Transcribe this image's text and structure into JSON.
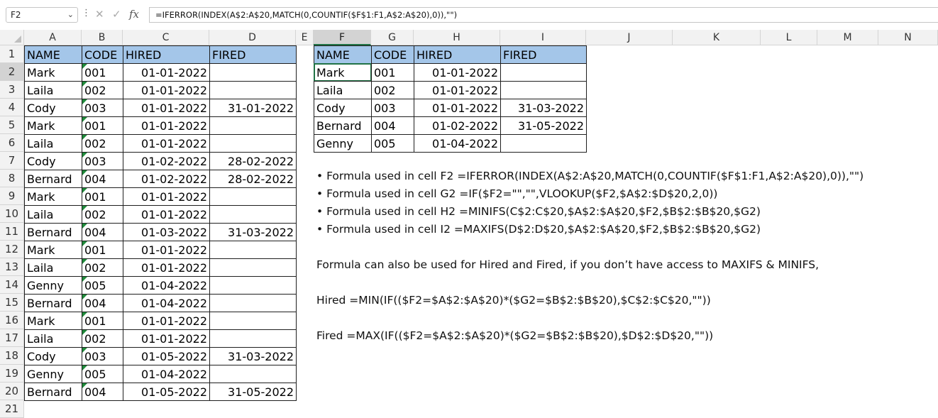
{
  "formula_bar": {
    "name_box": "F2",
    "cancel_icon": "✕",
    "enter_icon": "✓",
    "fx_label": "fx",
    "formula": "=IFERROR(INDEX(A$2:A$20,MATCH(0,COUNTIF($F$1:F1,A$2:A$20),0)),\"\")"
  },
  "columns": [
    "A",
    "B",
    "C",
    "D",
    "E",
    "F",
    "G",
    "H",
    "I",
    "J",
    "K",
    "L",
    "M",
    "N"
  ],
  "rows": [
    "1",
    "2",
    "3",
    "4",
    "5",
    "6",
    "7",
    "8",
    "9",
    "10",
    "11",
    "12",
    "13",
    "14",
    "15",
    "16",
    "17",
    "18",
    "19",
    "20",
    "21"
  ],
  "table1": {
    "headers": [
      "NAME",
      "CODE",
      "HIRED",
      "FIRED"
    ],
    "rows": [
      [
        "Mark",
        "001",
        "01-01-2022",
        ""
      ],
      [
        "Laila",
        "002",
        "01-01-2022",
        ""
      ],
      [
        "Cody",
        "003",
        "01-01-2022",
        "31-01-2022"
      ],
      [
        "Mark",
        "001",
        "01-01-2022",
        ""
      ],
      [
        "Laila",
        "002",
        "01-01-2022",
        ""
      ],
      [
        "Cody",
        "003",
        "01-02-2022",
        "28-02-2022"
      ],
      [
        "Bernard",
        "004",
        "01-02-2022",
        "28-02-2022"
      ],
      [
        "Mark",
        "001",
        "01-01-2022",
        ""
      ],
      [
        "Laila",
        "002",
        "01-01-2022",
        ""
      ],
      [
        "Bernard",
        "004",
        "01-03-2022",
        "31-03-2022"
      ],
      [
        "Mark",
        "001",
        "01-01-2022",
        ""
      ],
      [
        "Laila",
        "002",
        "01-01-2022",
        ""
      ],
      [
        "Genny",
        "005",
        "01-04-2022",
        ""
      ],
      [
        "Bernard",
        "004",
        "01-04-2022",
        ""
      ],
      [
        "Mark",
        "001",
        "01-01-2022",
        ""
      ],
      [
        "Laila",
        "002",
        "01-01-2022",
        ""
      ],
      [
        "Cody",
        "003",
        "01-05-2022",
        "31-03-2022"
      ],
      [
        "Genny",
        "005",
        "01-04-2022",
        ""
      ],
      [
        "Bernard",
        "004",
        "01-05-2022",
        "31-05-2022"
      ]
    ]
  },
  "table2": {
    "headers": [
      "NAME",
      "CODE",
      "HIRED",
      "FIRED"
    ],
    "rows": [
      [
        "Mark",
        "001",
        "01-01-2022",
        ""
      ],
      [
        "Laila",
        "002",
        "01-01-2022",
        ""
      ],
      [
        "Cody",
        "003",
        "01-01-2022",
        "31-03-2022"
      ],
      [
        "Bernard",
        "004",
        "01-02-2022",
        "31-05-2022"
      ],
      [
        "Genny",
        "005",
        "01-04-2022",
        ""
      ]
    ]
  },
  "notes": {
    "f2": "• Formula used in cell F2 =IFERROR(INDEX(A$2:A$20,MATCH(0,COUNTIF($F$1:F1,A$2:A$20),0)),\"\")",
    "g2": "• Formula used in cell G2 =IF($F2=\"\",\"\",VLOOKUP($F2,$A$2:$D$20,2,0))",
    "h2": "• Formula used in cell H2 =MINIFS(C$2:C$20,$A$2:$A$20,$F2,$B$2:$B$20,$G2)",
    "i2": "• Formula used in cell I2 =MAXIFS(D$2:D$20,$A$2:$A$20,$F2,$B$2:$B$20,$G2)",
    "alt_intro": "Formula can also be used for Hired and Fired, if you don’t have access to MAXIFS & MINIFS,",
    "hired": "Hired =MIN(IF(($F2=$A$2:$A$20)*($G2=$B$2:$B$20),$C$2:$C$20,\"\"))",
    "fired": "Fired =MAX(IF(($F2=$A$2:$A$20)*($G2=$B$2:$B$20),$D$2:$D$20,\"\"))"
  }
}
